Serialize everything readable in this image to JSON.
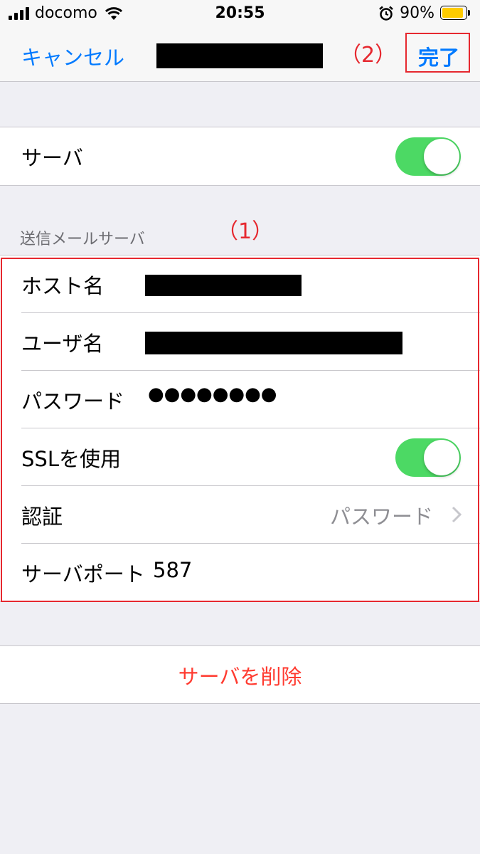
{
  "status_bar": {
    "carrier": "docomo",
    "time": "20:55",
    "battery": "90%",
    "battery_level": 0.9,
    "icons": [
      "signal-icon",
      "wifi-icon",
      "alarm-icon",
      "battery-icon"
    ],
    "battery_color": "#ffcc00"
  },
  "nav": {
    "cancel_label": "キャンセル",
    "done_label": "完了",
    "annotation": "（2）",
    "accent": "#007aff"
  },
  "server_toggle": {
    "label": "サーバ",
    "on": true
  },
  "outgoing": {
    "header": "送信メールサーバ",
    "annotation": "（1）",
    "rows": {
      "host_label": "ホスト名",
      "user_label": "ユーザ名",
      "password_label": "パスワード",
      "password_value": "●●●●●●●●",
      "ssl_label": "SSLを使用",
      "ssl_on": true,
      "auth_label": "認証",
      "auth_value": "パスワード",
      "port_label": "サーバポート",
      "port_value": "587"
    }
  },
  "delete_label": "サーバを削除",
  "colors": {
    "toggle_on": "#4cd964",
    "destructive": "#ff3b30",
    "annotation_red": "#e6282f",
    "background": "#efeff4"
  }
}
